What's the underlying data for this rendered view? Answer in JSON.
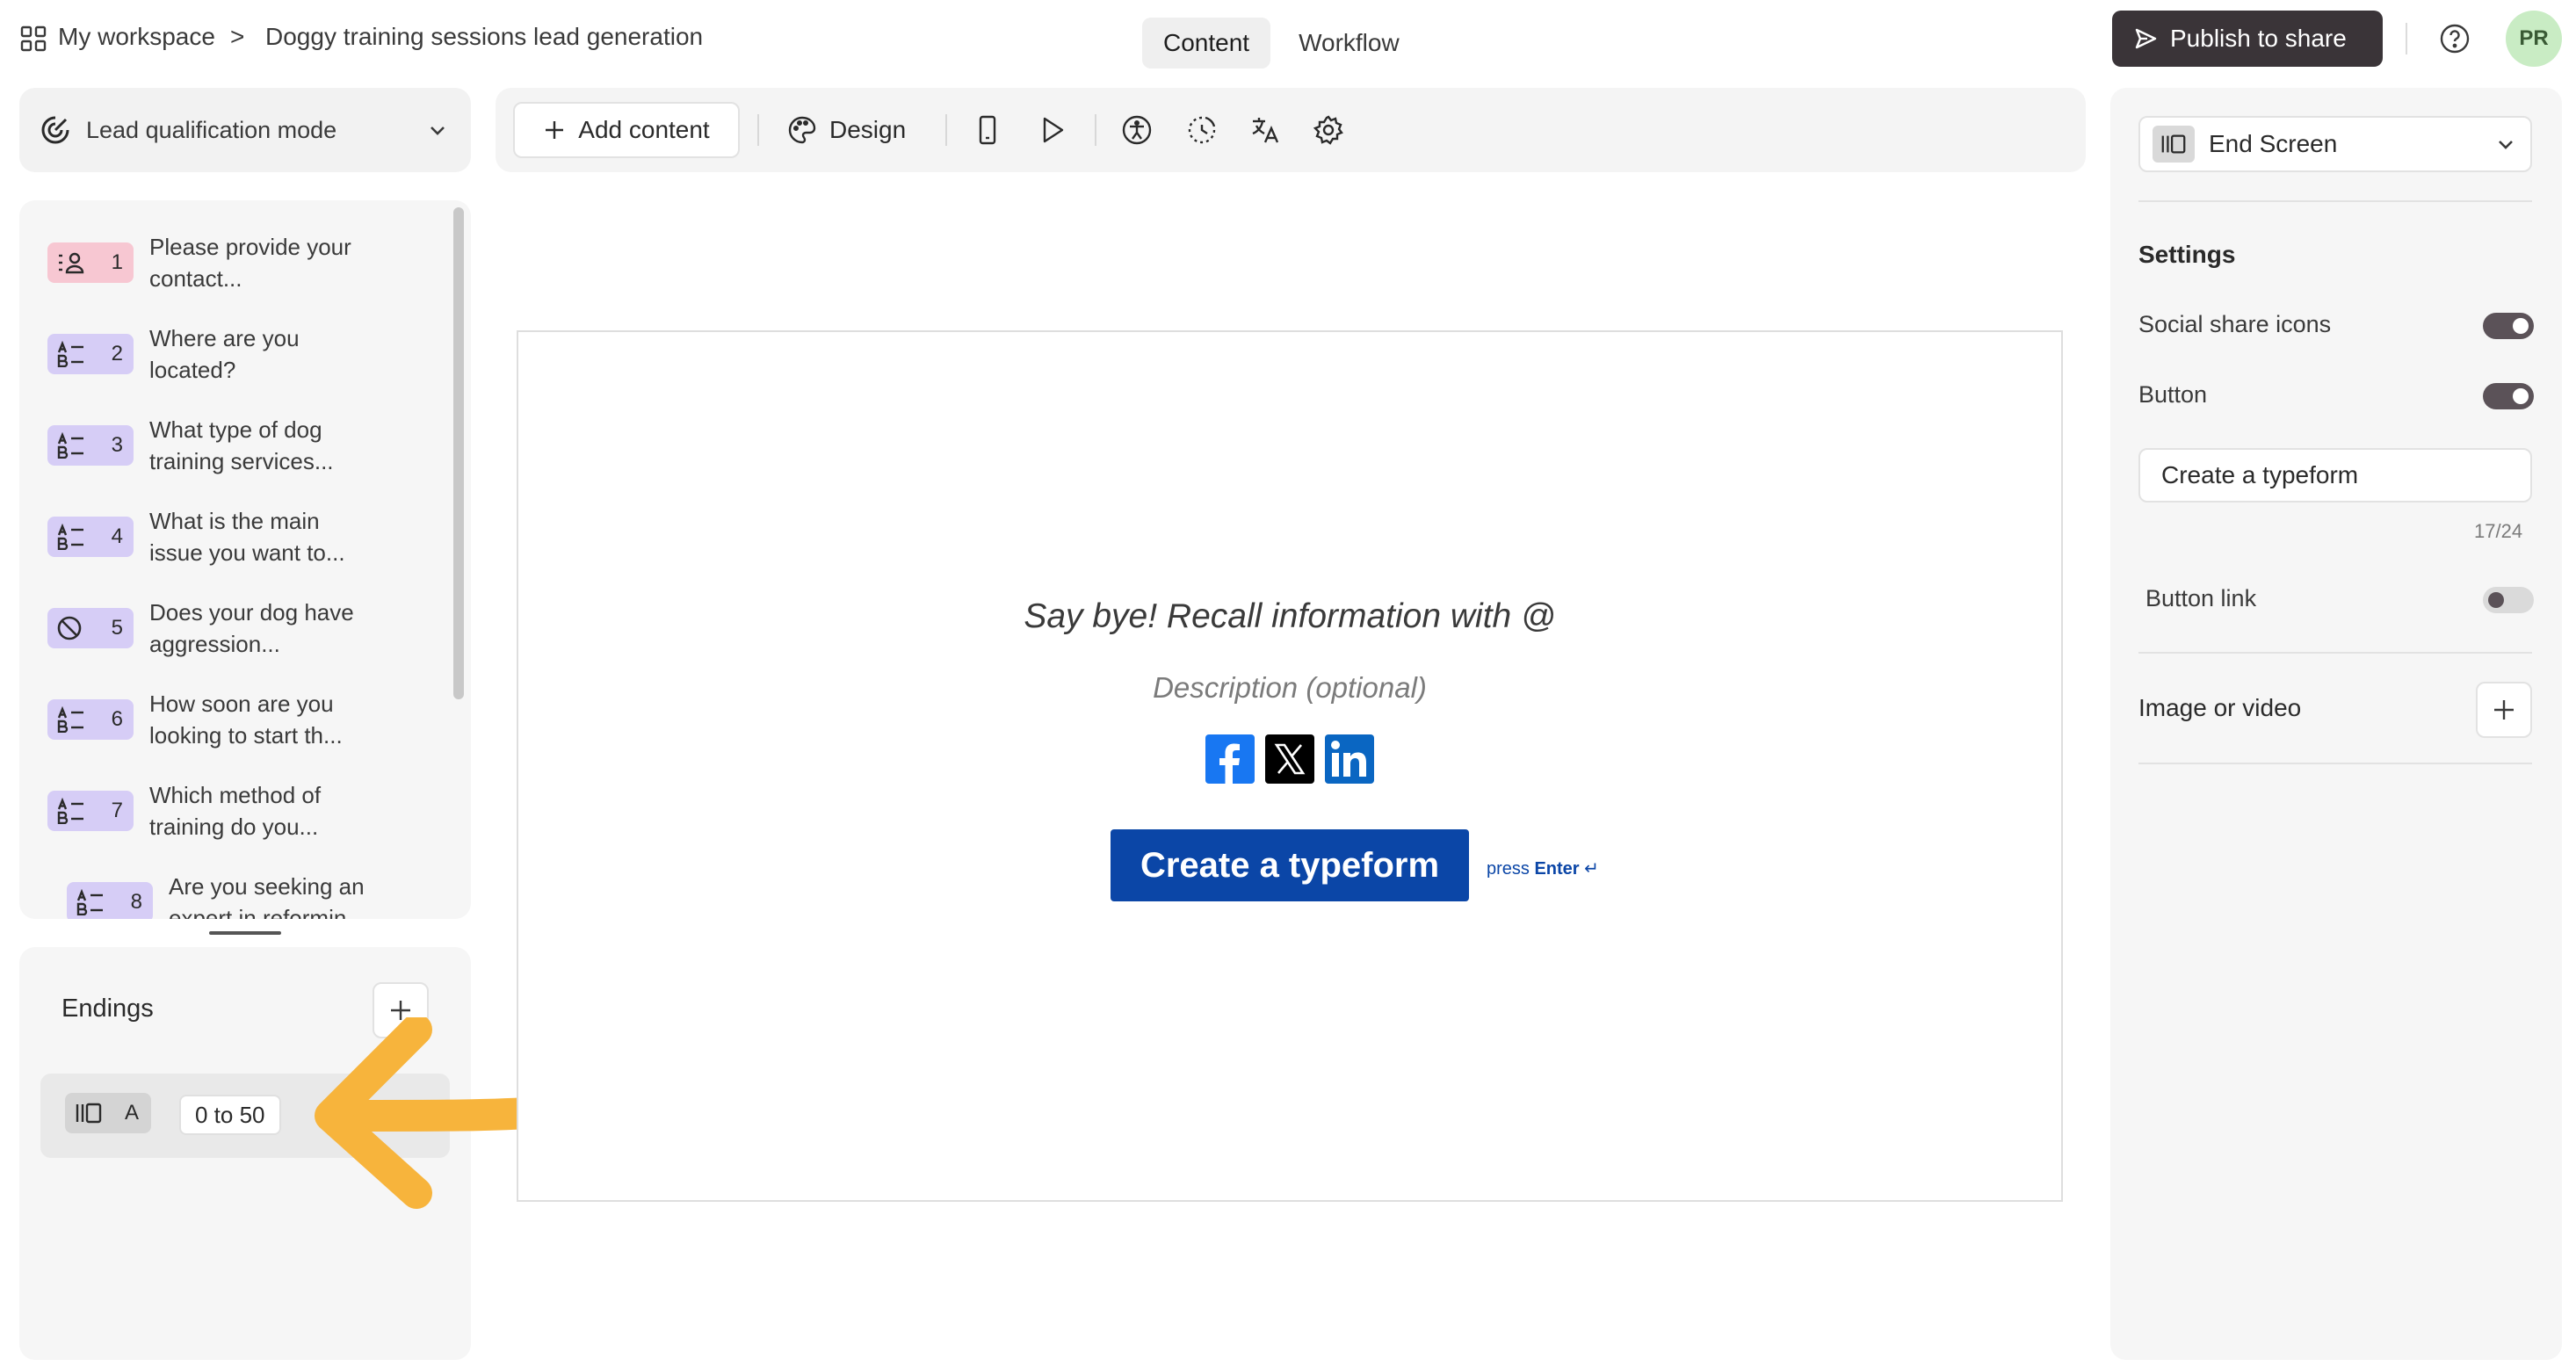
{
  "header": {
    "workspace": "My workspace",
    "separator": ">",
    "form_title": "Doggy training sessions lead generation",
    "tabs": [
      {
        "label": "Content",
        "active": true
      },
      {
        "label": "Workflow",
        "active": false
      }
    ],
    "publish_label": "Publish to share",
    "avatar_initials": "PR"
  },
  "sidebar": {
    "mode_label": "Lead qualification mode",
    "questions": [
      {
        "num": "1",
        "text": "Please provide your contact...",
        "icon": "contact-icon",
        "color": "#f7c7d2"
      },
      {
        "num": "2",
        "text": "Where are you located?",
        "icon": "list-icon",
        "color": "#d6cdf6"
      },
      {
        "num": "3",
        "text": "What type of dog training services...",
        "icon": "list-icon",
        "color": "#d6cdf6"
      },
      {
        "num": "4",
        "text": "What is the main issue you want to...",
        "icon": "list-icon",
        "color": "#d6cdf6"
      },
      {
        "num": "5",
        "text": "Does your dog have aggression...",
        "icon": "no-icon",
        "color": "#d6cdf6"
      },
      {
        "num": "6",
        "text": "How soon are you looking to start th...",
        "icon": "list-icon",
        "color": "#d6cdf6"
      },
      {
        "num": "7",
        "text": "Which method of training do you...",
        "icon": "list-icon",
        "color": "#d6cdf6"
      },
      {
        "num": "8",
        "text": "Are you seeking an expert in reformin",
        "icon": "list-icon",
        "color": "#d6cdf6"
      }
    ],
    "endings_title": "Endings",
    "endings": [
      {
        "letter": "A",
        "range": "0 to 50"
      }
    ]
  },
  "toolbar": {
    "add_content_label": "Add content",
    "design_label": "Design"
  },
  "canvas": {
    "title": "Say bye! Recall information with @",
    "description": "Description (optional)",
    "button_label": "Create a typeform",
    "press_hint_prefix": "press",
    "press_hint_key": "Enter",
    "press_hint_symbol": "↵"
  },
  "right_panel": {
    "screen_select": "End Screen",
    "settings_title": "Settings",
    "social_share_label": "Social share icons",
    "social_share_on": true,
    "button_label_text": "Button",
    "button_on": true,
    "button_text_value": "Create a typeform",
    "char_count": "17/24",
    "button_link_label": "Button link",
    "button_link_on": false,
    "image_video_label": "Image or video"
  },
  "colors": {
    "accent_button": "#0b46a7",
    "publish_bg": "#3a3438",
    "arrow": "#f7b43c"
  }
}
